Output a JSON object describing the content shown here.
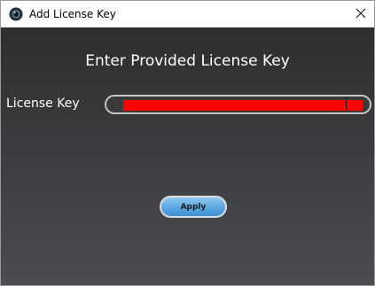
{
  "window": {
    "title": "Add License Key",
    "close_glyph": "✕",
    "app_icon": "app-logo-icon",
    "close_icon": "close-icon"
  },
  "form": {
    "heading": "Enter Provided License Key",
    "license_key_label": "License Key",
    "license_key_value": "",
    "apply_label": "Apply"
  },
  "colors": {
    "background_top": "#2e2e2e",
    "background_bottom": "#4b4c51",
    "redaction": "#ff0000",
    "button_accent": "#5aa7e1"
  }
}
